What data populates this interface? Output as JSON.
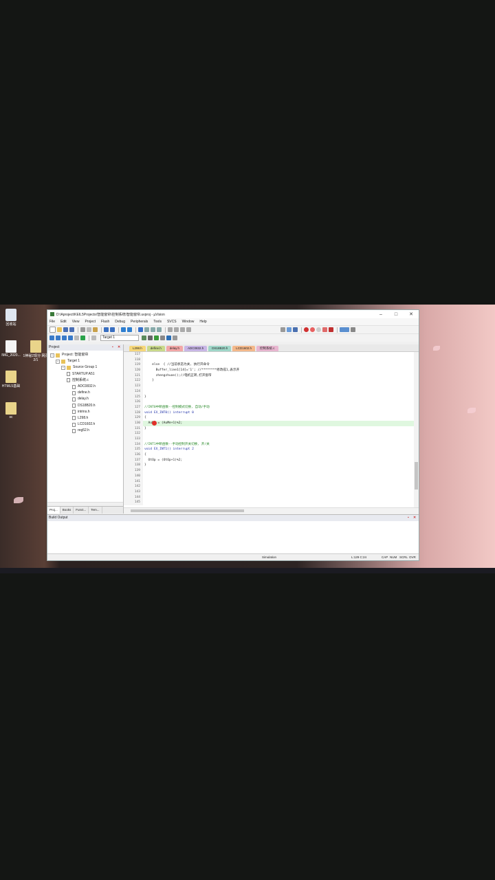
{
  "window": {
    "title": "D:\\Aproject\\KEIL5Projects\\智能窗帘\\控制系统\\智能窗帘.uvproj - µVision",
    "minimize": "–",
    "maximize": "□",
    "close": "✕"
  },
  "menu": [
    "File",
    "Edit",
    "View",
    "Project",
    "Flash",
    "Debug",
    "Peripherals",
    "Tools",
    "SVCS",
    "Window",
    "Help"
  ],
  "toolbar": {
    "target": "Target 1"
  },
  "desktop": {
    "icons": [
      "回收站",
      "IMG_2020...",
      "1神秘2现分 网页2/1",
      "HTML5基础",
      "sc"
    ]
  },
  "project": {
    "pane_title": "Project",
    "tree": [
      {
        "label": "Project: 智能窗帘",
        "type": "root",
        "indent": 0
      },
      {
        "label": "Target 1",
        "type": "folder",
        "indent": 1
      },
      {
        "label": "Source Group 1",
        "type": "folder",
        "indent": 2
      },
      {
        "label": "STARTUP.A51",
        "type": "file",
        "indent": 3
      },
      {
        "label": "控制系统.c",
        "type": "file",
        "indent": 3
      },
      {
        "label": "ADC0832.h",
        "type": "file",
        "indent": 4
      },
      {
        "label": "define.h",
        "type": "file",
        "indent": 4
      },
      {
        "label": "delay.h",
        "type": "file",
        "indent": 4
      },
      {
        "label": "DS18B20.h",
        "type": "file",
        "indent": 4
      },
      {
        "label": "intrins.h",
        "type": "file",
        "indent": 4
      },
      {
        "label": "L298.h",
        "type": "file",
        "indent": 4
      },
      {
        "label": "LCD1602.h",
        "type": "file",
        "indent": 4
      },
      {
        "label": "reg52.h",
        "type": "file",
        "indent": 4
      }
    ],
    "bottom_tabs": [
      "Proj...",
      "Books",
      "Funct...",
      "Tem..."
    ]
  },
  "editor": {
    "tabs": [
      {
        "label": "L298.h",
        "color": "#f6d77a"
      },
      {
        "label": "define.h",
        "color": "#c9d98a"
      },
      {
        "label": "delay.h",
        "color": "#f2a6a6"
      },
      {
        "label": "ADC0832.h",
        "color": "#c8b6e6"
      },
      {
        "label": "DS18B20.h",
        "color": "#9fd6c8"
      },
      {
        "label": "LCD1602.h",
        "color": "#f4b88a"
      },
      {
        "label": "控制系统.c",
        "color": "#e8b6d0"
      }
    ],
    "lines": [
      {
        "n": "117",
        "t": ""
      },
      {
        "n": "118",
        "t": ""
      },
      {
        "n": "119",
        "t": "    else  { //当前状态为关, 执行开命令"
      },
      {
        "n": "120",
        "t": "      Buffer_line1[14]='1'; //********修改成1,表示开"
      },
      {
        "n": "121",
        "t": "      zhengzhuan();//电机正转,打开窗帘"
      },
      {
        "n": "122",
        "t": "    }"
      },
      {
        "n": "123",
        "t": ""
      },
      {
        "n": "124",
        "t": ""
      },
      {
        "n": "125",
        "t": "}"
      },
      {
        "n": "126",
        "t": ""
      },
      {
        "n": "127",
        "t": "//INT0中断函数--控制模式切换, 自动/手动"
      },
      {
        "n": "128",
        "t": "void EX_INT0() interrupt 0"
      },
      {
        "n": "129",
        "t": "{"
      },
      {
        "n": "130",
        "t": "  AuMe = (AuMe+1)%2;"
      },
      {
        "n": "131",
        "t": "}"
      },
      {
        "n": "132",
        "t": ""
      },
      {
        "n": "133",
        "t": ""
      },
      {
        "n": "134",
        "t": "//INT1中断函数--手动控制开关切换, 开/关"
      },
      {
        "n": "135",
        "t": "void EX_INT1() interrupt 2"
      },
      {
        "n": "136",
        "t": "{"
      },
      {
        "n": "137",
        "t": "  OtOp = (OtOp+1)%2;"
      },
      {
        "n": "138",
        "t": "}"
      },
      {
        "n": "139",
        "t": ""
      },
      {
        "n": "140",
        "t": ""
      },
      {
        "n": "141",
        "t": ""
      },
      {
        "n": "142",
        "t": ""
      },
      {
        "n": "143",
        "t": ""
      },
      {
        "n": "144",
        "t": ""
      },
      {
        "n": "145",
        "t": ""
      }
    ],
    "highlight_line": "130"
  },
  "build": {
    "title": "Build Output"
  },
  "status": {
    "mode": "Simulation",
    "position": "L:129 C:24",
    "caps": "CAP",
    "num": "NUM",
    "scrl": "SCRL",
    "ovr": "OVR"
  }
}
